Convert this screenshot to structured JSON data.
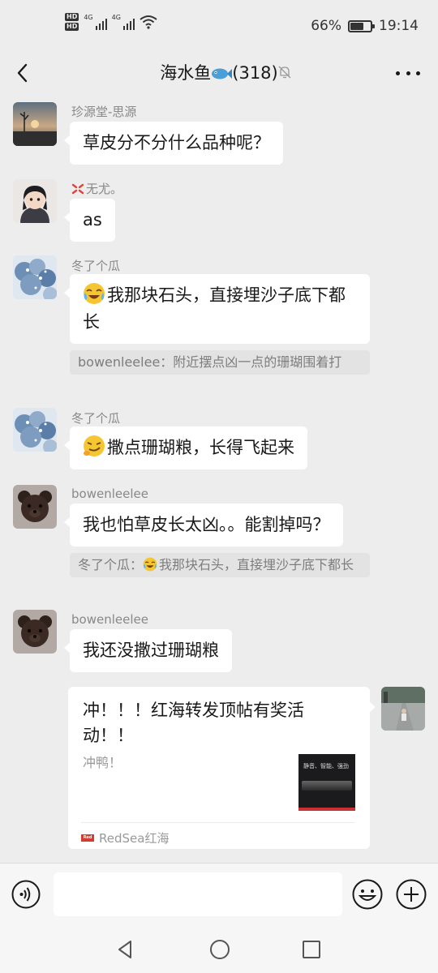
{
  "status_bar": {
    "battery_percent_label": "66%",
    "battery_level": 0.66,
    "time": "19:14",
    "hd_labels": [
      "HD",
      "HD"
    ],
    "network_labels": [
      "4G",
      "4G"
    ]
  },
  "header": {
    "title": "海水鱼",
    "member_count": "(318)"
  },
  "messages": [
    {
      "sender": "珍源堂-思源",
      "text": "草皮分不分什么品种呢？"
    },
    {
      "sender": "无尤。",
      "text": "as"
    },
    {
      "sender": "冬了个瓜",
      "text": "我那块石头，直接埋沙子底下都长",
      "quote": "bowenleelee：附近摆点凶一点的珊瑚围着打"
    },
    {
      "sender": "冬了个瓜",
      "text": "撒点珊瑚粮，长得飞起来"
    },
    {
      "sender": "bowenleelee",
      "text": "我也怕草皮长太凶。。能割掉吗？",
      "quote_name": "冬了个瓜：",
      "quote_text": "我那块石头，直接埋沙子底下都长"
    },
    {
      "sender": "bowenleelee",
      "text": "我还没撒过珊瑚粮"
    }
  ],
  "link_card": {
    "title": "冲！！！红海转发顶帖有奖活动！！",
    "description": "冲鸭！",
    "thumbnail_text": "静音、智能、强劲",
    "source_logo_text": "Red Sea",
    "source": "RedSea红海"
  },
  "colors": {
    "background": "#ededed",
    "bubble": "#ffffff",
    "quote_bg": "#e3e3e3",
    "secondary_text": "#888888",
    "source_logo": "#d43c2f"
  },
  "icons": [
    "back-arrow-icon",
    "fish-emoji-icon",
    "mute-bell-icon",
    "more-dots-icon",
    "voice-icon",
    "emoji-icon",
    "plus-icon",
    "nav-back-icon",
    "nav-home-icon",
    "nav-recent-icon"
  ]
}
